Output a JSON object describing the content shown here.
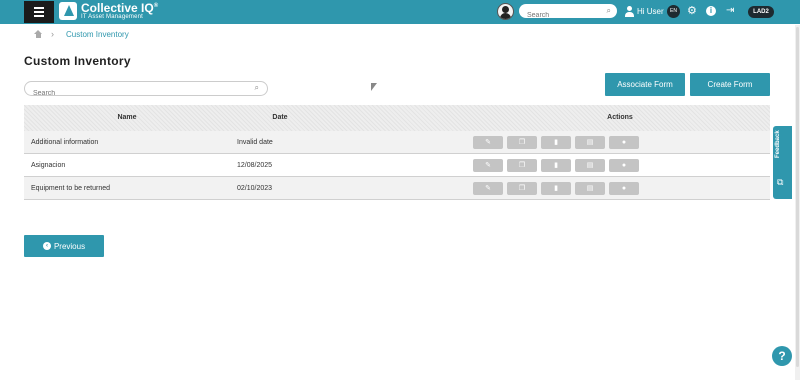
{
  "topbar": {
    "brand_title": "Collective IQ",
    "brand_reg": "®",
    "brand_subtitle": "IT Asset Management",
    "search_placeholder": "Search",
    "greeting": "Hi User",
    "language": "EN",
    "tenant": "LAD2",
    "accent_color": "#2f97ad"
  },
  "breadcrumb": {
    "separator": "›",
    "current": "Custom Inventory"
  },
  "page": {
    "title": "Custom Inventory",
    "search_placeholder": "Search"
  },
  "buttons": {
    "associate": "Associate Form",
    "create": "Create Form",
    "previous": "Previous"
  },
  "table": {
    "columns": [
      "Name",
      "Date",
      "Actions"
    ],
    "rows": [
      {
        "name": "Additional information",
        "date": "Invalid date"
      },
      {
        "name": "Asignacion",
        "date": "12/08/2025"
      },
      {
        "name": "Equipment to be returned",
        "date": "02/10/2023"
      }
    ],
    "action_icons": [
      "edit-icon",
      "copy-icon",
      "delete-icon",
      "document-icon",
      "user-icon"
    ]
  },
  "feedback": {
    "label": "Feedback"
  },
  "help": {
    "label": "?"
  }
}
